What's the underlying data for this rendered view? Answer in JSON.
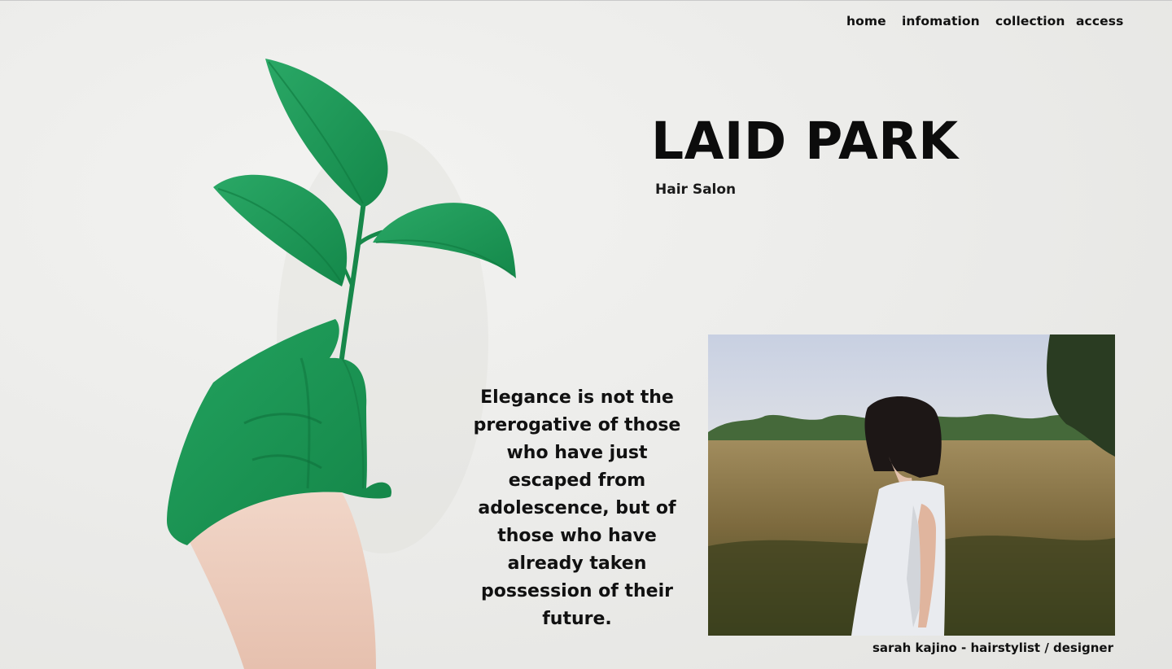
{
  "nav": {
    "items": [
      {
        "label": "home"
      },
      {
        "label": "infomation"
      },
      {
        "label": "collection"
      },
      {
        "label": "access"
      }
    ]
  },
  "hero": {
    "title": "LAID PARK",
    "subtitle": "Hair Salon",
    "image_icon": "plant-in-hand-image"
  },
  "quote": {
    "text": "Elegance is not the prerogative of those who have just escaped from adolescence, but of those who have already taken possession of their future."
  },
  "featured": {
    "image_icon": "woman-in-field-photo",
    "caption": "sarah kajino - hairstylist / designer"
  },
  "colors": {
    "background": "#ececea",
    "leaf_green": "#1e9a55",
    "text": "#111111"
  }
}
